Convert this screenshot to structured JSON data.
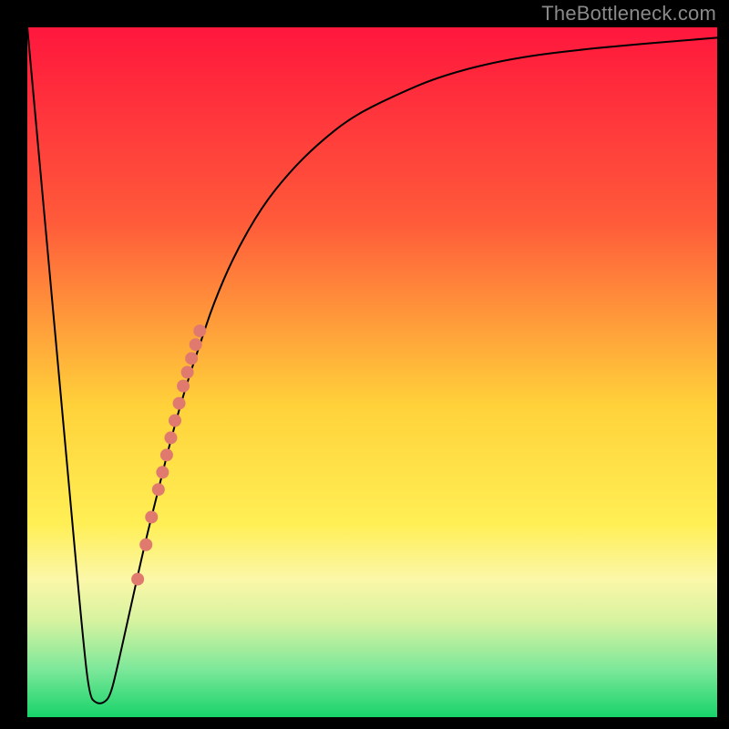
{
  "watermark": "TheBottleneck.com",
  "chart_data": {
    "type": "line",
    "title": "",
    "xlabel": "",
    "ylabel": "",
    "xlim": [
      0,
      100
    ],
    "ylim": [
      0,
      100
    ],
    "background": {
      "type": "vertical-gradient",
      "stops": [
        {
          "offset": 0.0,
          "color": "#ff173d"
        },
        {
          "offset": 0.28,
          "color": "#ff5a3a"
        },
        {
          "offset": 0.55,
          "color": "#ffd23a"
        },
        {
          "offset": 0.72,
          "color": "#ffef55"
        },
        {
          "offset": 0.8,
          "color": "#fbf7a8"
        },
        {
          "offset": 0.86,
          "color": "#d7f3a0"
        },
        {
          "offset": 0.93,
          "color": "#7ee89a"
        },
        {
          "offset": 1.0,
          "color": "#17d36a"
        }
      ]
    },
    "series": [
      {
        "name": "bottleneck-curve",
        "color": "#000000",
        "stroke_width": 2,
        "x": [
          0,
          2,
          4,
          6,
          8,
          9,
          10,
          11,
          12,
          13,
          15,
          17,
          19,
          21,
          23,
          25,
          27,
          30,
          34,
          38,
          42,
          47,
          53,
          60,
          70,
          82,
          100
        ],
        "y": [
          100,
          78,
          56,
          34,
          12,
          3,
          2,
          2,
          3,
          7,
          16,
          25,
          33,
          41,
          48,
          54,
          60,
          67,
          74,
          79,
          83,
          87,
          90,
          93,
          95.5,
          97,
          98.5
        ]
      }
    ],
    "scatter": {
      "name": "highlight-points",
      "color": "#e07a6e",
      "radius": 7,
      "points": [
        {
          "x": 19.0,
          "y": 33.0
        },
        {
          "x": 19.6,
          "y": 35.5
        },
        {
          "x": 20.2,
          "y": 38.0
        },
        {
          "x": 20.8,
          "y": 40.5
        },
        {
          "x": 21.4,
          "y": 43.0
        },
        {
          "x": 22.0,
          "y": 45.5
        },
        {
          "x": 22.6,
          "y": 48.0
        },
        {
          "x": 23.2,
          "y": 50.0
        },
        {
          "x": 23.8,
          "y": 52.0
        },
        {
          "x": 24.4,
          "y": 54.0
        },
        {
          "x": 25.0,
          "y": 56.0
        },
        {
          "x": 18.0,
          "y": 29.0
        },
        {
          "x": 17.2,
          "y": 25.0
        },
        {
          "x": 16.0,
          "y": 20.0
        }
      ]
    }
  }
}
